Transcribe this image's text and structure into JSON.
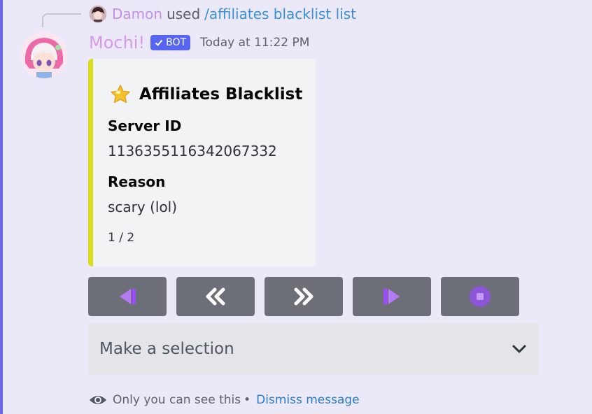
{
  "reply": {
    "user": "Damon",
    "used": "used",
    "command": "/affiliates blacklist list"
  },
  "message": {
    "bot_name": "Mochi!",
    "bot_tag": "BOT",
    "timestamp": "Today at 11:22 PM"
  },
  "embed": {
    "accent_color": "#d9dd19",
    "title": "Affiliates Blacklist",
    "title_icon": "star-icon",
    "fields": [
      {
        "name": "Server ID",
        "value": "1136355116342067332"
      },
      {
        "name": "Reason",
        "value": "scary (lol)"
      }
    ],
    "footer": "1 / 2"
  },
  "buttons": [
    {
      "icon": "first-page-icon"
    },
    {
      "icon": "double-chevron-left-icon"
    },
    {
      "icon": "double-chevron-right-icon"
    },
    {
      "icon": "last-page-icon"
    },
    {
      "icon": "stop-icon"
    }
  ],
  "select": {
    "placeholder": "Make a selection"
  },
  "ephemeral": {
    "text": "Only you can see this",
    "separator": "•",
    "dismiss": "Dismiss message"
  },
  "colors": {
    "background": "#ebe9f8",
    "button": "#6d6f78",
    "purple_icon": "#a05cf0",
    "link": "#2a7cc7",
    "bot_tag": "#5865f2"
  }
}
